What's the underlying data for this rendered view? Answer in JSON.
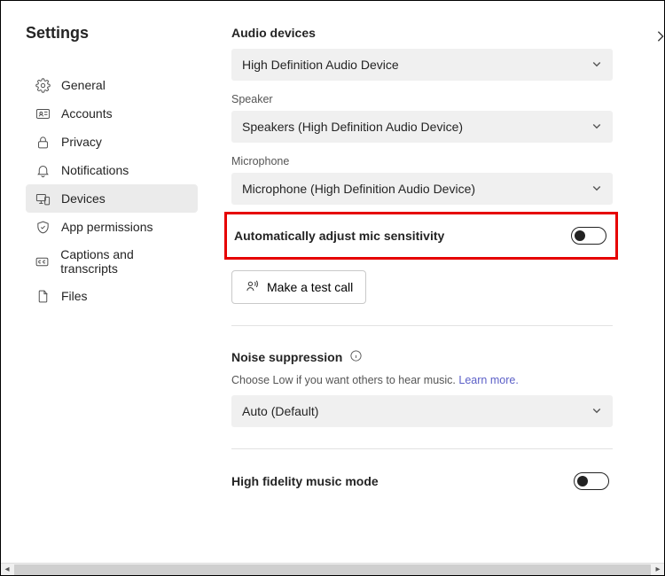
{
  "header": {
    "title": "Settings"
  },
  "sidebar": {
    "items": [
      {
        "label": "General",
        "icon": "gear-icon"
      },
      {
        "label": "Accounts",
        "icon": "id-card-icon"
      },
      {
        "label": "Privacy",
        "icon": "lock-icon"
      },
      {
        "label": "Notifications",
        "icon": "bell-icon"
      },
      {
        "label": "Devices",
        "icon": "phone-desktop-icon",
        "selected": true
      },
      {
        "label": "App permissions",
        "icon": "shield-icon"
      },
      {
        "label": "Captions and transcripts",
        "icon": "cc-icon"
      },
      {
        "label": "Files",
        "icon": "file-icon"
      }
    ]
  },
  "main": {
    "audio_devices": {
      "title": "Audio devices",
      "primary_select": "High Definition Audio Device",
      "speaker_label": "Speaker",
      "speaker_select": "Speakers (High Definition Audio Device)",
      "mic_label": "Microphone",
      "mic_select": "Microphone (High Definition Audio Device)"
    },
    "auto_mic": {
      "label": "Automatically adjust mic sensitivity",
      "value": false
    },
    "test_call_button": "Make a test call",
    "noise_suppression": {
      "title": "Noise suppression",
      "subtitle_prefix": "Choose Low if you want others to hear music. ",
      "learn_more": "Learn more.",
      "select": "Auto (Default)"
    },
    "hifi": {
      "label": "High fidelity music mode",
      "value": false
    }
  }
}
